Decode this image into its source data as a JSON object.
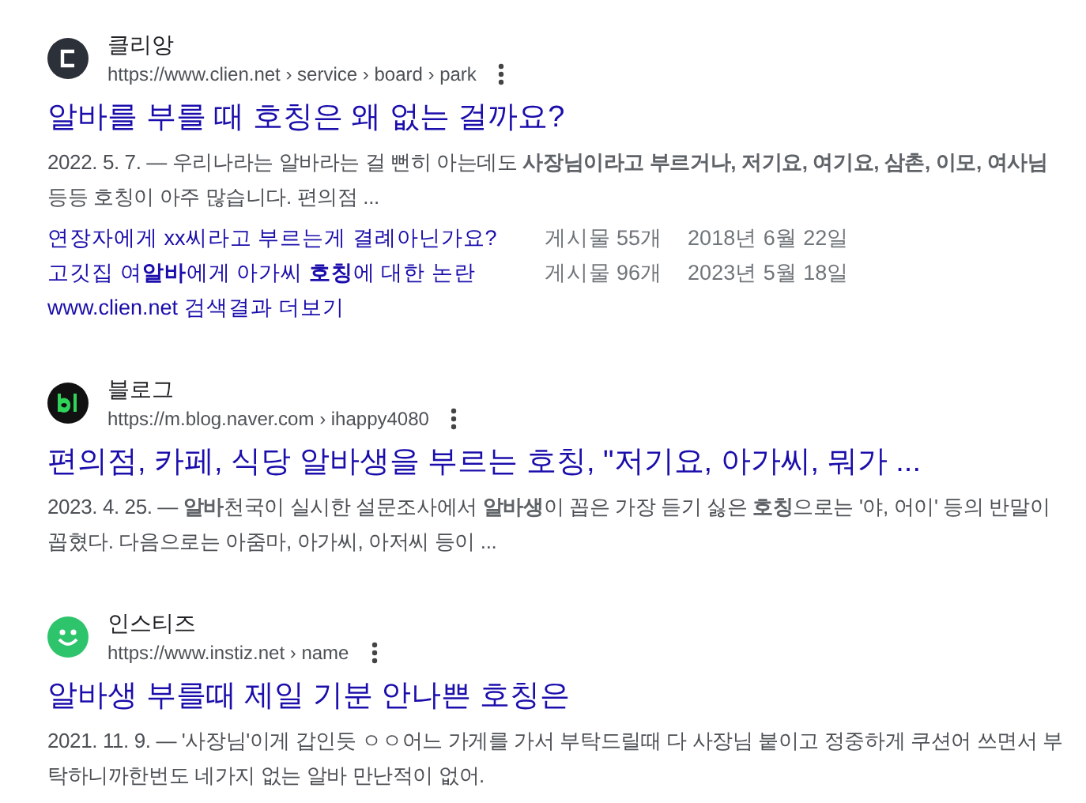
{
  "results": [
    {
      "kind": "clien",
      "site": "클리앙",
      "url": "https://www.clien.net › service › board › park",
      "title": "알바를 부를 때 호칭은 왜 없는 걸까요?",
      "snippet": "2022. 5. 7. — 우리나라는 알바라는 걸 뻔히 아는데도 **사장님이라고 부르거나, 저기요, 여기요, 삼촌, 이모, 여사님** 등등 호칭이 아주 많습니다. 편의점 ...",
      "sitelinks": [
        {
          "title": "연장자에게 xx씨라고 부르는게 결례아닌가요?",
          "count": "게시물 55개",
          "date": "2018년 6월 22일"
        },
        {
          "title": "고깃집 여**알바**에게 아가씨 **호칭**에 대한 논란",
          "count": "게시물 96개",
          "date": "2023년 5월 18일"
        }
      ],
      "more": "www.clien.net 검색결과 더보기"
    },
    {
      "kind": "blog",
      "site": "블로그",
      "url": "https://m.blog.naver.com › ihappy4080",
      "title": "편의점, 카페, 식당 알바생을 부르는 호칭, \"저기요, 아가씨, 뭐가 ...",
      "snippet": "2023. 4. 25. — **알바**천국이 실시한 설문조사에서 **알바생**이 꼽은 가장 듣기 싫은 **호칭**으로는 '야, 어이' 등의 반말이 꼽혔다. 다음으로는 아줌마, 아가씨, 아저씨 등이 ..."
    },
    {
      "kind": "smile",
      "site": "인스티즈",
      "url": "https://www.instiz.net › name",
      "title": "알바생 부를때 제일 기분 안나쁜 호칭은",
      "snippet": "2021. 11. 9. — '사장님'이게 갑인듯 ㅇㅇ어느 가게를 가서 부탁드릴때 다 사장님 붙이고 정중하게 쿠션어 쓰면서 부탁하니까한번도 네가지 없는 알바 만난적이 없어."
    }
  ]
}
